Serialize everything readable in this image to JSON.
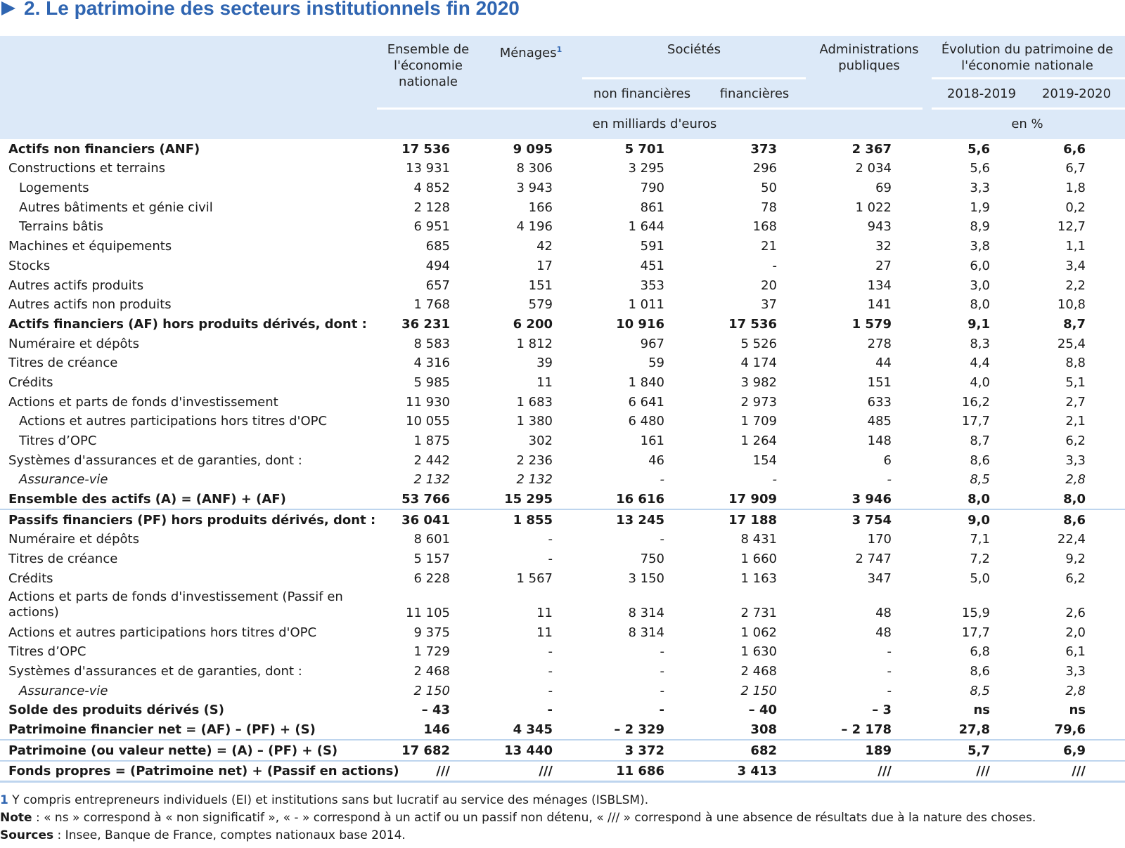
{
  "title": "2. Le patrimoine des secteurs institutionnels fin 2020",
  "header": {
    "ensemble": "Ensemble de l'économie nationale",
    "menages": "Ménages",
    "menages_sup": "1",
    "societes": "Sociétés",
    "non_financieres": "non financières",
    "financieres": "financières",
    "admin": "Administrations publiques",
    "evolution": "Évolution du patrimoine de l'économie nationale",
    "y1": "2018-2019",
    "y2": "2019-2020",
    "unit_eur": "en milliards d'euros",
    "unit_pct": "en %"
  },
  "rows": [
    {
      "label": "Actifs non financiers (ANF)",
      "style": "bold",
      "values": [
        "17 536",
        "9 095",
        "5 701",
        "373",
        "2 367",
        "5,6",
        "6,6"
      ]
    },
    {
      "label": "Constructions et terrains",
      "style": "",
      "values": [
        "13 931",
        "8 306",
        "3 295",
        "296",
        "2 034",
        "5,6",
        "6,7"
      ]
    },
    {
      "label": "Logements",
      "style": "indent",
      "values": [
        "4 852",
        "3 943",
        "790",
        "50",
        "69",
        "3,3",
        "1,8"
      ]
    },
    {
      "label": "Autres bâtiments et génie civil",
      "style": "indent",
      "values": [
        "2 128",
        "166",
        "861",
        "78",
        "1 022",
        "1,9",
        "0,2"
      ]
    },
    {
      "label": "Terrains bâtis",
      "style": "indent",
      "values": [
        "6 951",
        "4 196",
        "1 644",
        "168",
        "943",
        "8,9",
        "12,7"
      ]
    },
    {
      "label": "Machines et équipements",
      "style": "",
      "values": [
        "685",
        "42",
        "591",
        "21",
        "32",
        "3,8",
        "1,1"
      ]
    },
    {
      "label": "Stocks",
      "style": "",
      "values": [
        "494",
        "17",
        "451",
        "-",
        "27",
        "6,0",
        "3,4"
      ]
    },
    {
      "label": "Autres actifs produits",
      "style": "",
      "values": [
        "657",
        "151",
        "353",
        "20",
        "134",
        "3,0",
        "2,2"
      ]
    },
    {
      "label": "Autres actifs non produits",
      "style": "",
      "values": [
        "1 768",
        "579",
        "1 011",
        "37",
        "141",
        "8,0",
        "10,8"
      ]
    },
    {
      "label": "Actifs financiers (AF) hors produits dérivés, dont :",
      "style": "bold",
      "values": [
        "36 231",
        "6 200",
        "10 916",
        "17 536",
        "1 579",
        "9,1",
        "8,7"
      ]
    },
    {
      "label": "Numéraire et dépôts",
      "style": "",
      "values": [
        "8 583",
        "1 812",
        "967",
        "5 526",
        "278",
        "8,3",
        "25,4"
      ]
    },
    {
      "label": "Titres de créance",
      "style": "",
      "values": [
        "4 316",
        "39",
        "59",
        "4 174",
        "44",
        "4,4",
        "8,8"
      ]
    },
    {
      "label": "Crédits",
      "style": "",
      "values": [
        "5 985",
        "11",
        "1 840",
        "3 982",
        "151",
        "4,0",
        "5,1"
      ]
    },
    {
      "label": "Actions et parts de fonds d'investissement",
      "style": "",
      "values": [
        "11 930",
        "1 683",
        "6 641",
        "2 973",
        "633",
        "16,2",
        "2,7"
      ]
    },
    {
      "label": "Actions et autres participations hors titres d'OPC",
      "style": "indent",
      "values": [
        "10 055",
        "1 380",
        "6 480",
        "1 709",
        "485",
        "17,7",
        "2,1"
      ]
    },
    {
      "label": "Titres d’OPC",
      "style": "indent",
      "values": [
        "1 875",
        "302",
        "161",
        "1 264",
        "148",
        "8,7",
        "6,2"
      ]
    },
    {
      "label": "Systèmes d'assurances et de garanties, dont :",
      "style": "",
      "values": [
        "2 442",
        "2 236",
        "46",
        "154",
        "6",
        "8,6",
        "3,3"
      ]
    },
    {
      "label": "Assurance-vie",
      "style": "indent italic",
      "values": [
        "2 132",
        "2 132",
        "-",
        "-",
        "-",
        "8,5",
        "2,8"
      ]
    },
    {
      "label": "Ensemble des actifs (A) = (ANF) + (AF)",
      "style": "bold",
      "values": [
        "53 766",
        "15 295",
        "16 616",
        "17 909",
        "3 946",
        "8,0",
        "8,0"
      ]
    },
    {
      "label": "Passifs financiers (PF) hors produits dérivés, dont :",
      "style": "bold sep",
      "values": [
        "36 041",
        "1 855",
        "13 245",
        "17 188",
        "3 754",
        "9,0",
        "8,6"
      ]
    },
    {
      "label": "Numéraire et dépôts",
      "style": "",
      "values": [
        "8 601",
        "-",
        "-",
        "8 431",
        "170",
        "7,1",
        "22,4"
      ]
    },
    {
      "label": "Titres de créance",
      "style": "",
      "values": [
        "5 157",
        "-",
        "750",
        "1 660",
        "2 747",
        "7,2",
        "9,2"
      ]
    },
    {
      "label": "Crédits",
      "style": "",
      "values": [
        "6 228",
        "1 567",
        "3 150",
        "1 163",
        "347",
        "5,0",
        "6,2"
      ]
    },
    {
      "label": "Actions et parts de fonds d'investissement (Passif en actions)",
      "style": "twoline",
      "values": [
        "11 105",
        "11",
        "8 314",
        "2 731",
        "48",
        "15,9",
        "2,6"
      ]
    },
    {
      "label": "Actions et autres participations hors titres d'OPC",
      "style": "",
      "values": [
        "9 375",
        "11",
        "8 314",
        "1 062",
        "48",
        "17,7",
        "2,0"
      ]
    },
    {
      "label": "Titres d’OPC",
      "style": "",
      "values": [
        "1 729",
        "-",
        "-",
        "1 630",
        "-",
        "6,8",
        "6,1"
      ]
    },
    {
      "label": "Systèmes d'assurances et de garanties, dont :",
      "style": "",
      "values": [
        "2 468",
        "-",
        "-",
        "2 468",
        "-",
        "8,6",
        "3,3"
      ]
    },
    {
      "label": "Assurance-vie",
      "style": "indent italic",
      "values": [
        "2 150",
        "-",
        "-",
        "2 150",
        "-",
        "8,5",
        "2,8"
      ]
    },
    {
      "label": "Solde des produits dérivés (S)",
      "style": "bold",
      "values": [
        "– 43",
        "-",
        "-",
        "– 40",
        "– 3",
        "ns",
        "ns"
      ]
    },
    {
      "label": "Patrimoine financier net = (AF) – (PF) + (S)",
      "style": "bold",
      "values": [
        "146",
        "4 345",
        "– 2 329",
        "308",
        "– 2 178",
        "27,8",
        "79,6"
      ]
    },
    {
      "label": "Patrimoine (ou valeur nette) = (A) – (PF) + (S)",
      "style": "bold sep",
      "values": [
        "17 682",
        "13 440",
        "3 372",
        "682",
        "189",
        "5,7",
        "6,9"
      ]
    },
    {
      "label": "Fonds propres = (Patrimoine net) + (Passif en actions)",
      "style": "bold sep last",
      "values": [
        "///",
        "///",
        "11 686",
        "3 413",
        "///",
        "///",
        "///"
      ]
    }
  ],
  "footnotes": {
    "fn1_num": "1",
    "fn1_text": " Y compris entrepreneurs individuels (EI) et institutions sans but lucratif au service des ménages (ISBLSM).",
    "note_label": "Note",
    "note_text": " : « ns » correspond à « non significatif », « - » correspond à un actif ou un passif non détenu, « /// » correspond à une absence de résultats due à la nature des choses.",
    "sources_label": "Sources",
    "sources_text": " : Insee, Banque de France, comptes nationaux base 2014."
  },
  "colors": {
    "accent": "#2f65b1",
    "header_bg": "#dce9f8",
    "rule": "#bed5ee"
  }
}
